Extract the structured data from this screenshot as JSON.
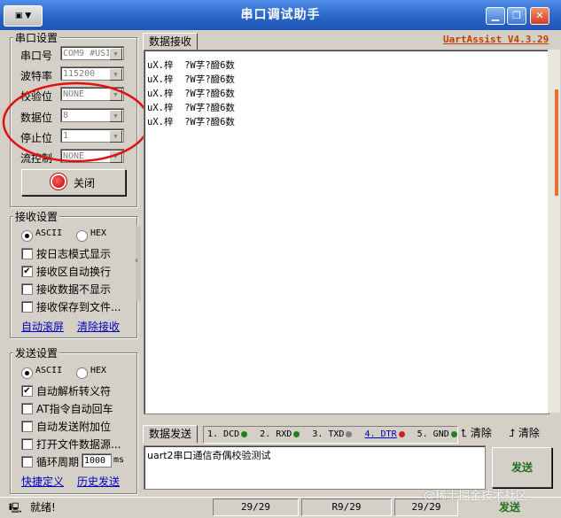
{
  "window": {
    "title": "串口调试助手",
    "system_menu": "▼",
    "btn_min": "▁",
    "btn_restore": "❐",
    "btn_close": "✕",
    "title_color": "#2a66c8"
  },
  "serial_settings": {
    "group_label": "串口设置",
    "fields": [
      {
        "label": "串口号",
        "value": "COM9 #USI"
      },
      {
        "label": "波特率",
        "value": "115200"
      },
      {
        "label": "校验位",
        "value": "NONE"
      },
      {
        "label": "数据位",
        "value": "8"
      },
      {
        "label": "停止位",
        "value": "1"
      },
      {
        "label": "流控制",
        "value": "NONE"
      }
    ],
    "close_button_label": "关闭"
  },
  "receive_settings": {
    "group_label": "接收设置",
    "radio_ascii": "ASCII",
    "radio_hex": "HEX",
    "radio_selected": "ASCII",
    "options": [
      {
        "label": "按日志模式显示",
        "checked": false
      },
      {
        "label": "接收区自动换行",
        "checked": true
      },
      {
        "label": "接收数据不显示",
        "checked": false
      },
      {
        "label": "接收保存到文件...",
        "checked": false
      }
    ],
    "link_auto_scroll": "自动滚屏",
    "link_clear_recv": "清除接收"
  },
  "send_settings": {
    "group_label": "发送设置",
    "radio_ascii": "ASCII",
    "radio_hex": "HEX",
    "radio_selected": "ASCII",
    "options": [
      {
        "label": "自动解析转义符",
        "checked": true
      },
      {
        "label": "AT指令自动回车",
        "checked": false
      },
      {
        "label": "自动发送附加位",
        "checked": false
      },
      {
        "label": "打开文件数据源...",
        "checked": false
      }
    ],
    "cycle_label": "循环周期",
    "cycle_value": "1000",
    "cycle_unit": "ms",
    "link_shortcut": "快捷定义",
    "link_history": "历史发送"
  },
  "receive_panel": {
    "tab_label": "数据接收",
    "brand": "UartAssist V4.3.29",
    "brand_color": "#c04000",
    "lines": [
      "uX.梓  ?W芓?醱6数",
      "uX.梓  ?W芓?醱6数",
      "uX.梓  ?W芓?醱6数",
      "uX.梓  ?W芓?醱6数",
      "uX.梓  ?W芓?醱6数"
    ]
  },
  "send_panel": {
    "tab_label": "数据发送",
    "signals": [
      {
        "label": "1. DCD",
        "color": "#208020"
      },
      {
        "label": "2. RXD",
        "color": "#208020"
      },
      {
        "label": "3. TXD",
        "color": "#808080"
      },
      {
        "label": "4. DTR",
        "color": "#d02020"
      },
      {
        "label": "5. GND",
        "color": "#208020"
      },
      {
        "label": "6.",
        "color": ""
      }
    ],
    "clear_label_1": "清除",
    "clear_label_2": "清除",
    "input_value": "uart2串口通信奇偶校验测试",
    "send_button_label": "发送"
  },
  "status_bar": {
    "ready_text": "就绪!",
    "send_count": "29/29",
    "recv_count": "R9/29",
    "total_count": "29/29",
    "reset_label": "发送"
  },
  "watermark": "@稀土掘金技术社区"
}
